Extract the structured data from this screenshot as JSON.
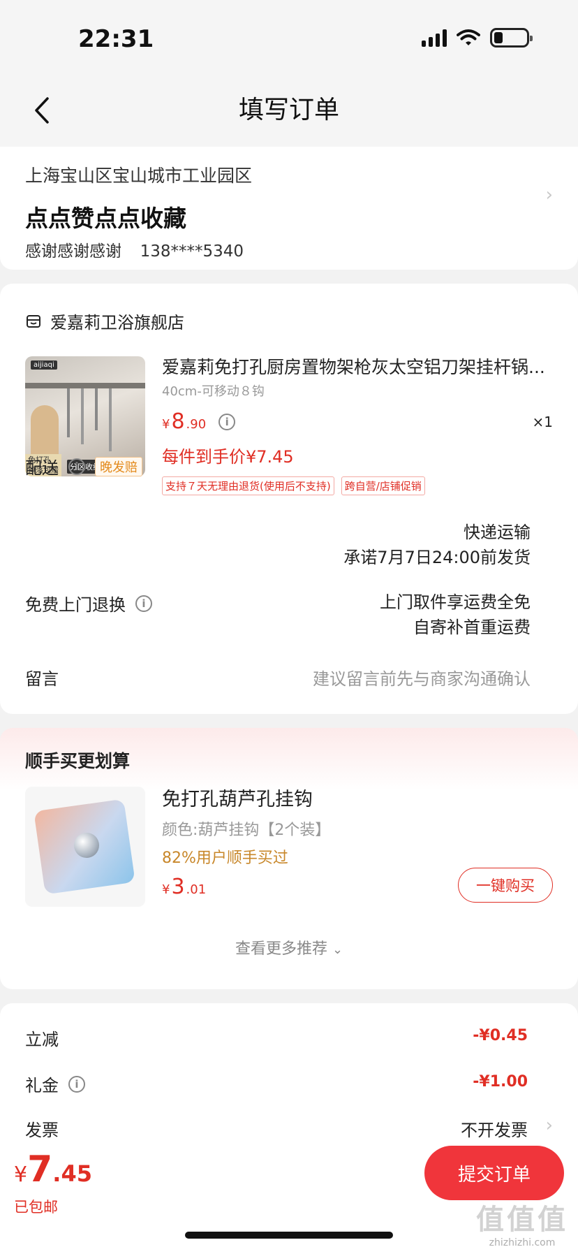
{
  "status_bar": {
    "time": "22:31"
  },
  "nav": {
    "title": "填写订单"
  },
  "address": {
    "region": "上海宝山区宝山城市工业园区",
    "street": "点点赞点点收藏",
    "name": "感谢感谢感谢",
    "phone": "138****5340"
  },
  "order": {
    "store_name": "爱嘉莉卫浴旗舰店",
    "product": {
      "image_brand": "aijiaqi",
      "image_caption_1": "免打孔",
      "image_caption_2": "掉落包赔",
      "image_caption_3": "分区收纳 整洁有序",
      "title": "爱嘉莉免打孔厨房置物架枪灰太空铝刀架挂杆锅...",
      "spec": "40cm-可移动８钩",
      "price_currency": "¥",
      "price_int": "8",
      "price_dec": ".90",
      "quantity": "×1",
      "final_price": "每件到手价¥7.45",
      "tags": [
        "支持７天无理由退货(使用后不支持)",
        "跨自营/店铺促销"
      ]
    },
    "delivery": {
      "label": "配送",
      "badge": "晚发赔",
      "method": "快递运输",
      "promise": "承诺7月7日24:00前发货"
    },
    "return": {
      "label": "免费上门退换",
      "line1": "上门取件享运费全免",
      "line2": "自寄补首重运费"
    },
    "message": {
      "label": "留言",
      "placeholder": "建议留言前先与商家沟通确认"
    }
  },
  "recommend": {
    "title": "顺手买更划算",
    "item": {
      "name": "免打孔葫芦孔挂钩",
      "spec": "颜色:葫芦挂钩【2个装】",
      "popularity": "82%用户顺手买过",
      "price_currency": "¥",
      "price_int": "3",
      "price_dec": ".01",
      "buy_label": "一键购买"
    },
    "more_label": "查看更多推荐"
  },
  "summary": {
    "discount_label": "立减",
    "discount_value": "-¥0.45",
    "coupon_label": "礼金",
    "coupon_value": "-¥1.00",
    "invoice_label": "发票",
    "invoice_value": "不开发票"
  },
  "bottom_bar": {
    "currency": "¥",
    "total_int": "7",
    "total_dec": ".45",
    "shipping": "已包邮",
    "submit_label": "提交订单"
  },
  "watermark": {
    "big": "值值值",
    "small": "zhizhizhi.com"
  },
  "colors": {
    "accent": "#e02e24",
    "submit_bg": "#f0353b",
    "popularity": "#c8872a",
    "late_badge": "#e38a1c"
  }
}
